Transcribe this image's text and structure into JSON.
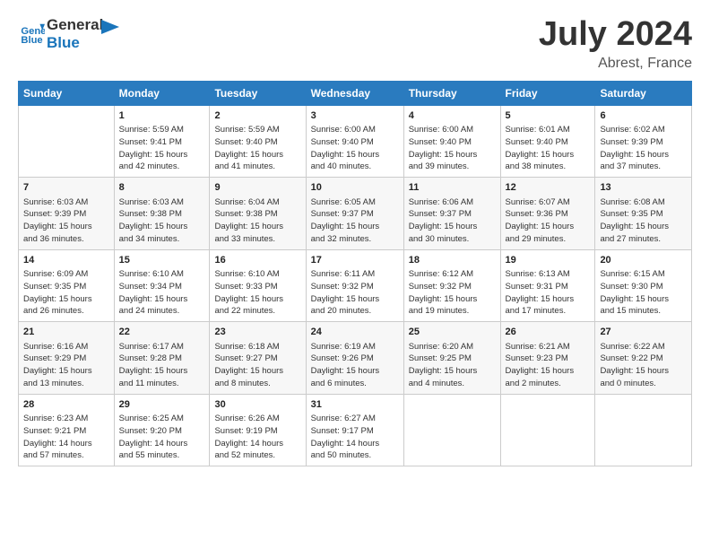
{
  "header": {
    "logo_line1": "General",
    "logo_line2": "Blue",
    "month": "July 2024",
    "location": "Abrest, France"
  },
  "weekdays": [
    "Sunday",
    "Monday",
    "Tuesday",
    "Wednesday",
    "Thursday",
    "Friday",
    "Saturday"
  ],
  "weeks": [
    [
      {
        "day": "",
        "info": ""
      },
      {
        "day": "1",
        "info": "Sunrise: 5:59 AM\nSunset: 9:41 PM\nDaylight: 15 hours\nand 42 minutes."
      },
      {
        "day": "2",
        "info": "Sunrise: 5:59 AM\nSunset: 9:40 PM\nDaylight: 15 hours\nand 41 minutes."
      },
      {
        "day": "3",
        "info": "Sunrise: 6:00 AM\nSunset: 9:40 PM\nDaylight: 15 hours\nand 40 minutes."
      },
      {
        "day": "4",
        "info": "Sunrise: 6:00 AM\nSunset: 9:40 PM\nDaylight: 15 hours\nand 39 minutes."
      },
      {
        "day": "5",
        "info": "Sunrise: 6:01 AM\nSunset: 9:40 PM\nDaylight: 15 hours\nand 38 minutes."
      },
      {
        "day": "6",
        "info": "Sunrise: 6:02 AM\nSunset: 9:39 PM\nDaylight: 15 hours\nand 37 minutes."
      }
    ],
    [
      {
        "day": "7",
        "info": "Sunrise: 6:03 AM\nSunset: 9:39 PM\nDaylight: 15 hours\nand 36 minutes."
      },
      {
        "day": "8",
        "info": "Sunrise: 6:03 AM\nSunset: 9:38 PM\nDaylight: 15 hours\nand 34 minutes."
      },
      {
        "day": "9",
        "info": "Sunrise: 6:04 AM\nSunset: 9:38 PM\nDaylight: 15 hours\nand 33 minutes."
      },
      {
        "day": "10",
        "info": "Sunrise: 6:05 AM\nSunset: 9:37 PM\nDaylight: 15 hours\nand 32 minutes."
      },
      {
        "day": "11",
        "info": "Sunrise: 6:06 AM\nSunset: 9:37 PM\nDaylight: 15 hours\nand 30 minutes."
      },
      {
        "day": "12",
        "info": "Sunrise: 6:07 AM\nSunset: 9:36 PM\nDaylight: 15 hours\nand 29 minutes."
      },
      {
        "day": "13",
        "info": "Sunrise: 6:08 AM\nSunset: 9:35 PM\nDaylight: 15 hours\nand 27 minutes."
      }
    ],
    [
      {
        "day": "14",
        "info": "Sunrise: 6:09 AM\nSunset: 9:35 PM\nDaylight: 15 hours\nand 26 minutes."
      },
      {
        "day": "15",
        "info": "Sunrise: 6:10 AM\nSunset: 9:34 PM\nDaylight: 15 hours\nand 24 minutes."
      },
      {
        "day": "16",
        "info": "Sunrise: 6:10 AM\nSunset: 9:33 PM\nDaylight: 15 hours\nand 22 minutes."
      },
      {
        "day": "17",
        "info": "Sunrise: 6:11 AM\nSunset: 9:32 PM\nDaylight: 15 hours\nand 20 minutes."
      },
      {
        "day": "18",
        "info": "Sunrise: 6:12 AM\nSunset: 9:32 PM\nDaylight: 15 hours\nand 19 minutes."
      },
      {
        "day": "19",
        "info": "Sunrise: 6:13 AM\nSunset: 9:31 PM\nDaylight: 15 hours\nand 17 minutes."
      },
      {
        "day": "20",
        "info": "Sunrise: 6:15 AM\nSunset: 9:30 PM\nDaylight: 15 hours\nand 15 minutes."
      }
    ],
    [
      {
        "day": "21",
        "info": "Sunrise: 6:16 AM\nSunset: 9:29 PM\nDaylight: 15 hours\nand 13 minutes."
      },
      {
        "day": "22",
        "info": "Sunrise: 6:17 AM\nSunset: 9:28 PM\nDaylight: 15 hours\nand 11 minutes."
      },
      {
        "day": "23",
        "info": "Sunrise: 6:18 AM\nSunset: 9:27 PM\nDaylight: 15 hours\nand 8 minutes."
      },
      {
        "day": "24",
        "info": "Sunrise: 6:19 AM\nSunset: 9:26 PM\nDaylight: 15 hours\nand 6 minutes."
      },
      {
        "day": "25",
        "info": "Sunrise: 6:20 AM\nSunset: 9:25 PM\nDaylight: 15 hours\nand 4 minutes."
      },
      {
        "day": "26",
        "info": "Sunrise: 6:21 AM\nSunset: 9:23 PM\nDaylight: 15 hours\nand 2 minutes."
      },
      {
        "day": "27",
        "info": "Sunrise: 6:22 AM\nSunset: 9:22 PM\nDaylight: 15 hours\nand 0 minutes."
      }
    ],
    [
      {
        "day": "28",
        "info": "Sunrise: 6:23 AM\nSunset: 9:21 PM\nDaylight: 14 hours\nand 57 minutes."
      },
      {
        "day": "29",
        "info": "Sunrise: 6:25 AM\nSunset: 9:20 PM\nDaylight: 14 hours\nand 55 minutes."
      },
      {
        "day": "30",
        "info": "Sunrise: 6:26 AM\nSunset: 9:19 PM\nDaylight: 14 hours\nand 52 minutes."
      },
      {
        "day": "31",
        "info": "Sunrise: 6:27 AM\nSunset: 9:17 PM\nDaylight: 14 hours\nand 50 minutes."
      },
      {
        "day": "",
        "info": ""
      },
      {
        "day": "",
        "info": ""
      },
      {
        "day": "",
        "info": ""
      }
    ]
  ]
}
